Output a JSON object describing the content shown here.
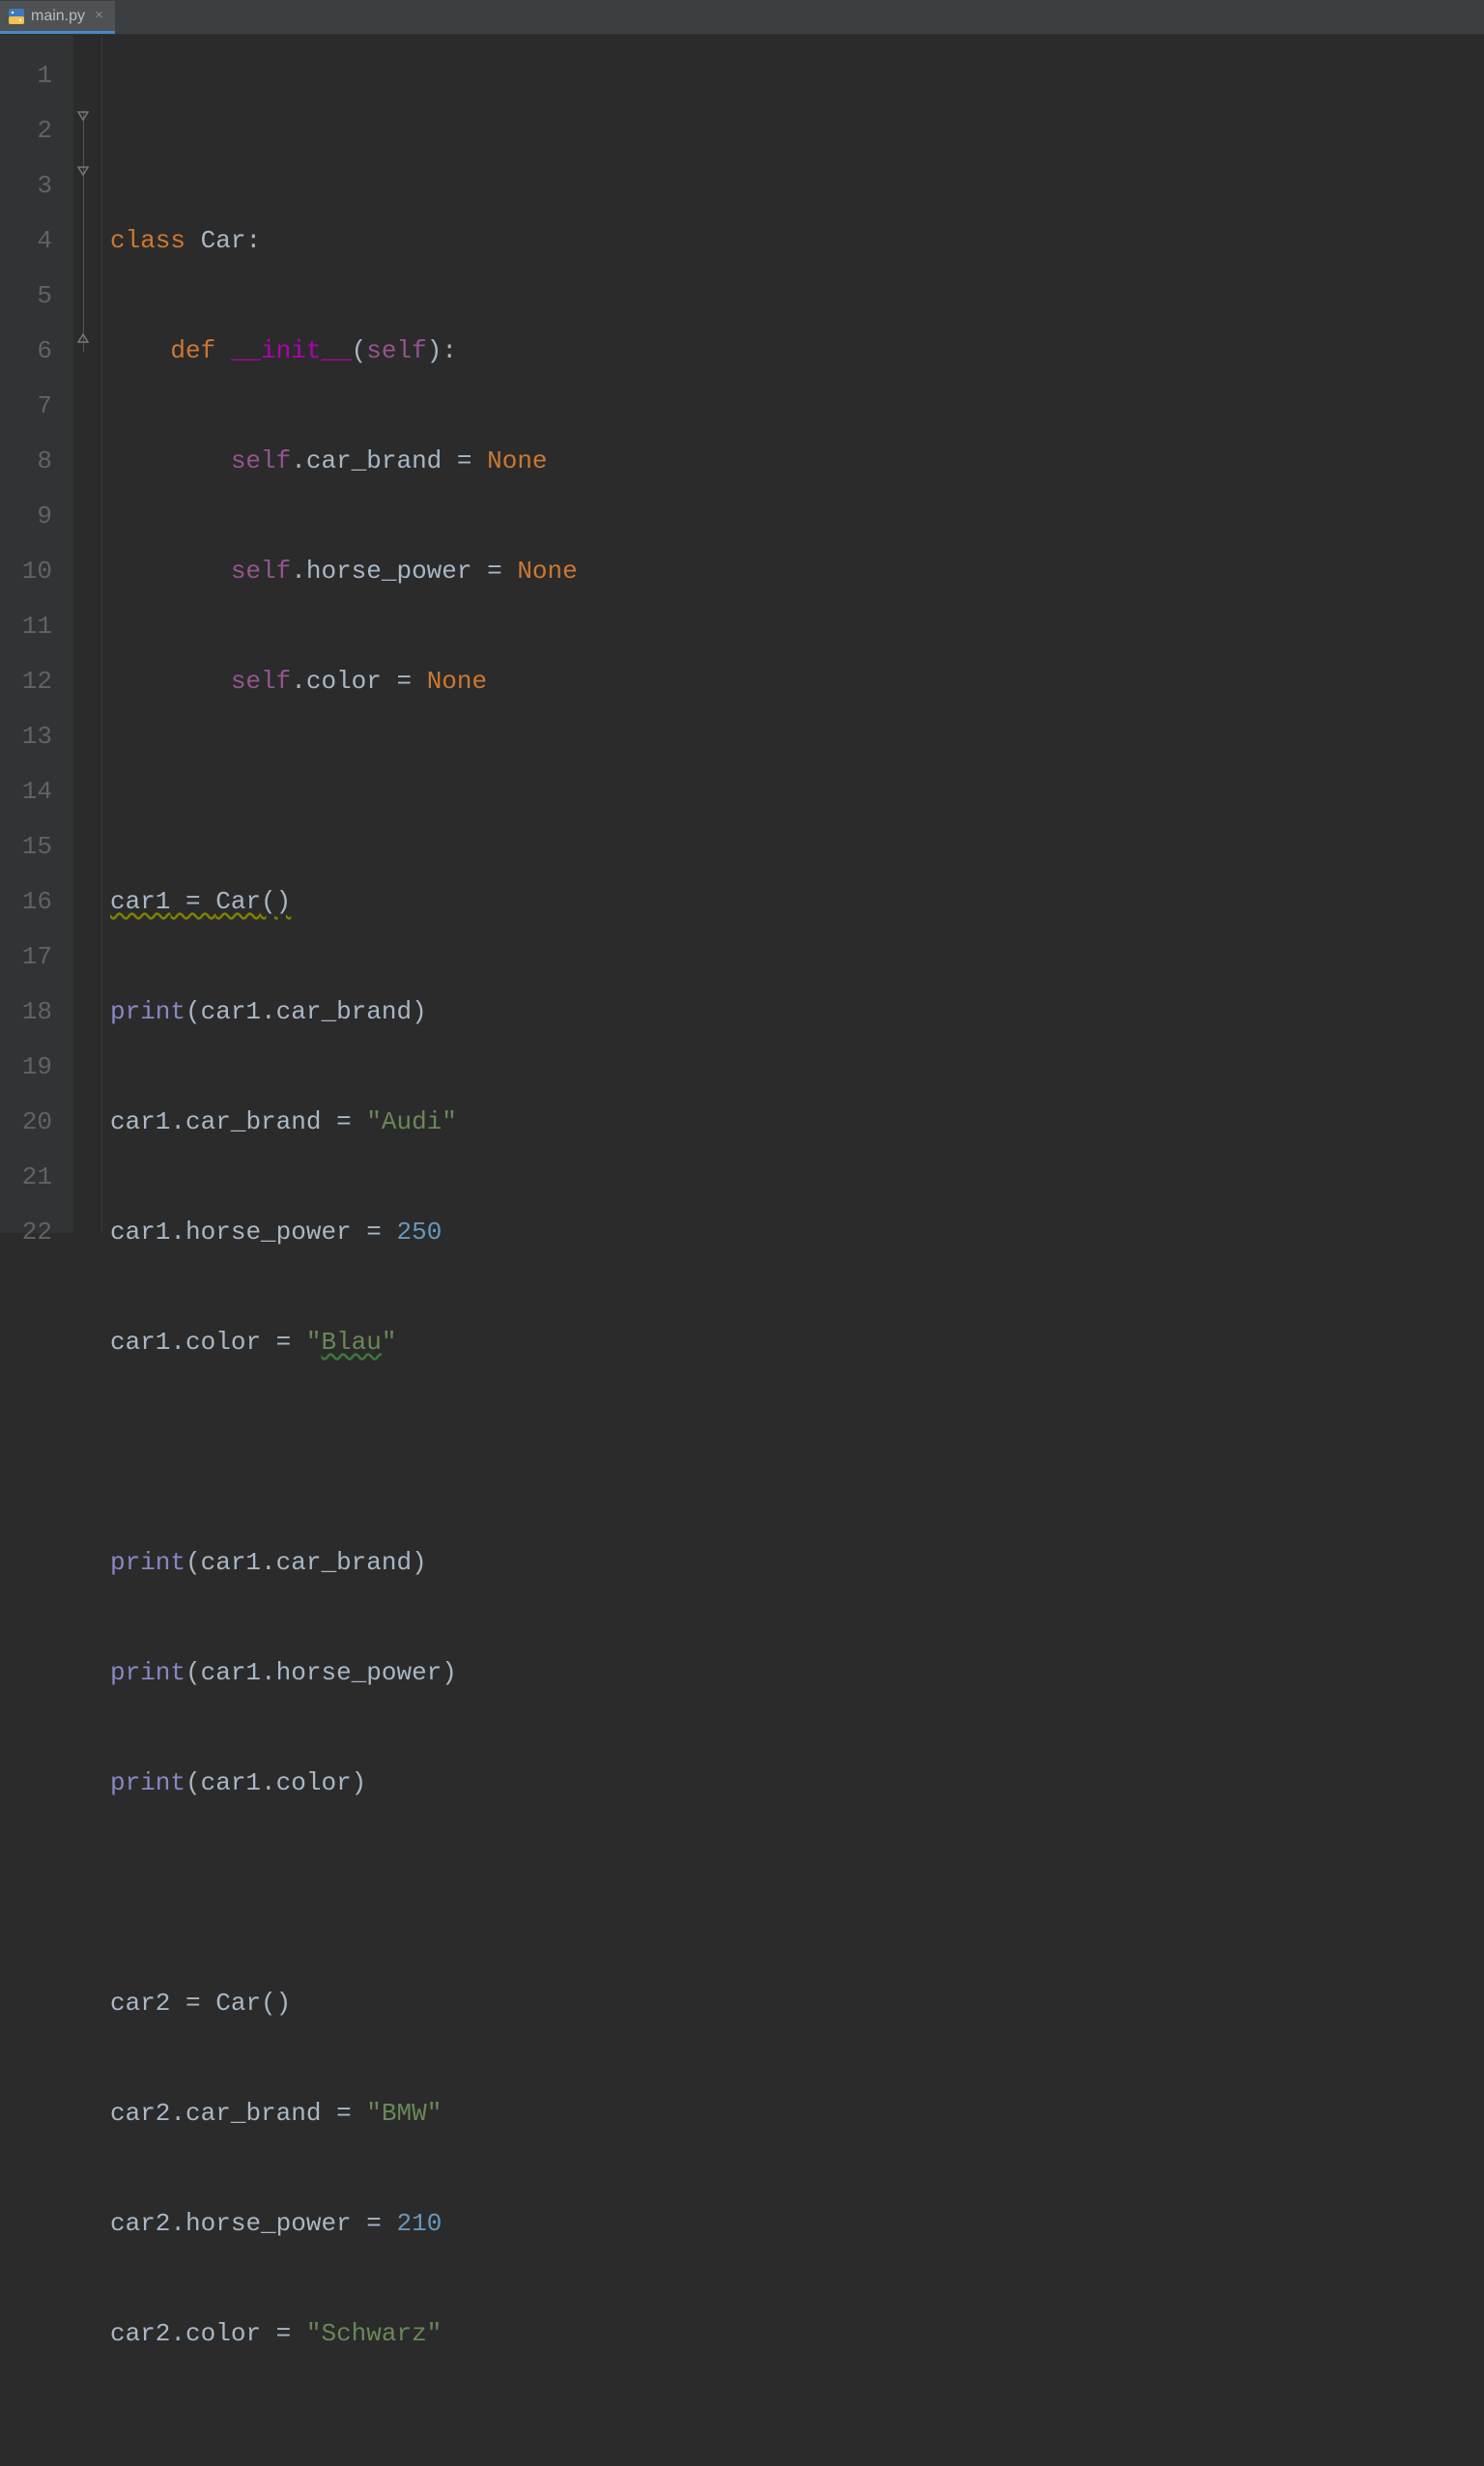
{
  "tab": {
    "filename": "main.py",
    "close_glyph": "×"
  },
  "gutter": {
    "lines": [
      "1",
      "2",
      "3",
      "4",
      "5",
      "6",
      "7",
      "8",
      "9",
      "10",
      "11",
      "12",
      "13",
      "14",
      "15",
      "16",
      "17",
      "18",
      "19",
      "20",
      "21",
      "22"
    ]
  },
  "code": {
    "l2": {
      "kw": "class",
      "cls": "Car",
      "colon": ":"
    },
    "l3": {
      "kw": "def",
      "fn": "__init__",
      "lp": "(",
      "param": "self",
      "rp": ")",
      "colon": ":"
    },
    "l4": {
      "self": "self",
      "dot": ".",
      "attr": "car_brand",
      "eq": " = ",
      "val": "None"
    },
    "l5": {
      "self": "self",
      "dot": ".",
      "attr": "horse_power",
      "eq": " = ",
      "val": "None"
    },
    "l6": {
      "self": "self",
      "dot": ".",
      "attr": "color",
      "eq": " = ",
      "val": "None"
    },
    "l8": {
      "var": "car1",
      "eq": " = ",
      "cls": "Car",
      "call": "()"
    },
    "l9": {
      "fn": "print",
      "lp": "(",
      "var": "car1",
      "dot": ".",
      "attr": "car_brand",
      "rp": ")"
    },
    "l10": {
      "var": "car1",
      "dot": ".",
      "attr": "car_brand",
      "eq": " = ",
      "str": "\"Audi\""
    },
    "l11": {
      "var": "car1",
      "dot": ".",
      "attr": "horse_power",
      "eq": " = ",
      "num": "250"
    },
    "l12": {
      "var": "car1",
      "dot": ".",
      "attr": "color",
      "eq": " = ",
      "q1": "\"",
      "strmid": "Blau",
      "q2": "\""
    },
    "l14": {
      "fn": "print",
      "lp": "(",
      "var": "car1",
      "dot": ".",
      "attr": "car_brand",
      "rp": ")"
    },
    "l15": {
      "fn": "print",
      "lp": "(",
      "var": "car1",
      "dot": ".",
      "attr": "horse_power",
      "rp": ")"
    },
    "l16": {
      "fn": "print",
      "lp": "(",
      "var": "car1",
      "dot": ".",
      "attr": "color",
      "rp": ")"
    },
    "l18": {
      "var": "car2",
      "eq": " = ",
      "cls": "Car",
      "call": "()"
    },
    "l19": {
      "var": "car2",
      "dot": ".",
      "attr": "car_brand",
      "eq": " = ",
      "str": "\"BMW\""
    },
    "l20": {
      "var": "car2",
      "dot": ".",
      "attr": "horse_power",
      "eq": " = ",
      "num": "210"
    },
    "l21": {
      "var": "car2",
      "dot": ".",
      "attr": "color",
      "eq": " = ",
      "str": "\"Schwarz\""
    }
  }
}
